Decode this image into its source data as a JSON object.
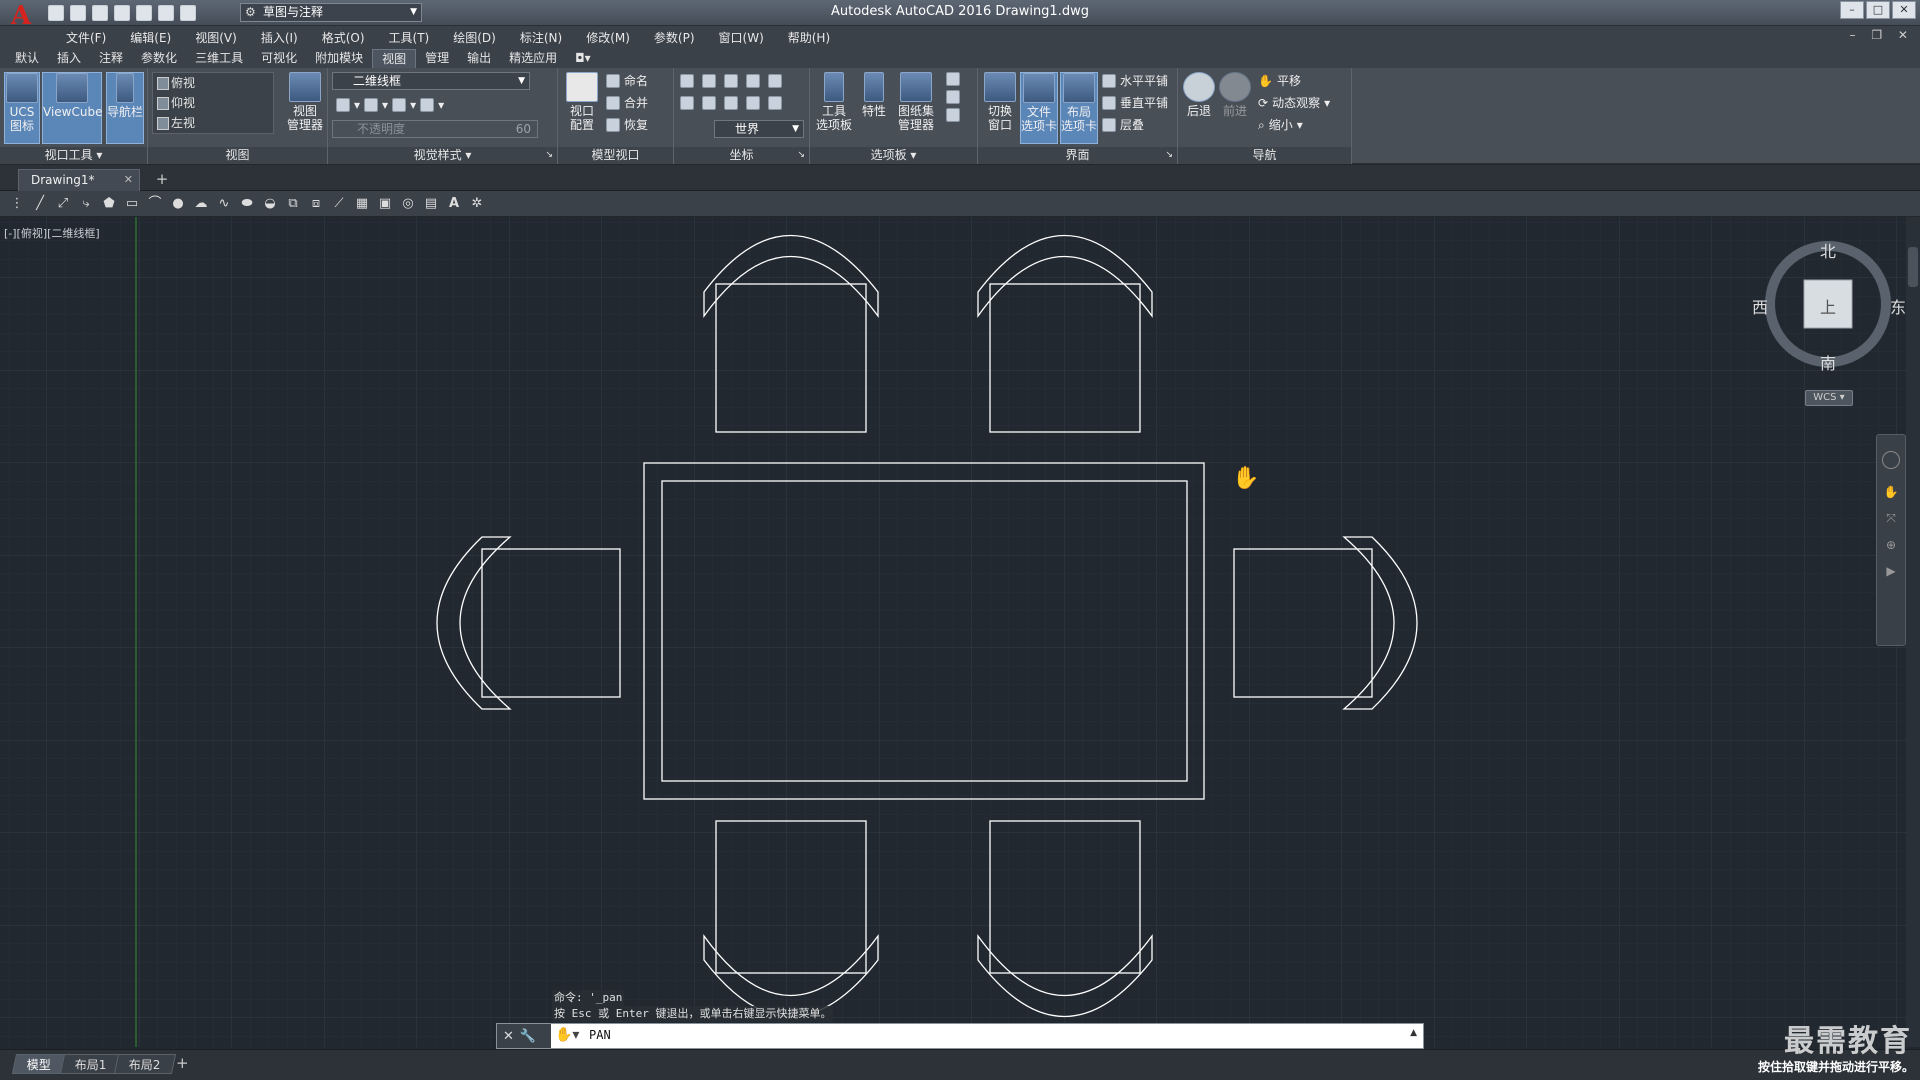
{
  "app": {
    "title": "Autodesk AutoCAD 2016    Drawing1.dwg",
    "logo": "A",
    "workspace": "草图与注释",
    "window_controls": [
      "–",
      "□",
      "✕"
    ]
  },
  "menu": [
    "文件(F)",
    "编辑(E)",
    "视图(V)",
    "插入(I)",
    "格式(O)",
    "工具(T)",
    "绘图(D)",
    "标注(N)",
    "修改(M)",
    "参数(P)",
    "窗口(W)",
    "帮助(H)"
  ],
  "ribbon_tabs": [
    "默认",
    "插入",
    "注释",
    "参数化",
    "三维工具",
    "可视化",
    "附加模块",
    "视图",
    "管理",
    "输出",
    "精选应用"
  ],
  "active_tab": "视图",
  "ribbon": {
    "viewport_tools": {
      "title": "视口工具",
      "ucs": "UCS\n图标",
      "viewcube": "ViewCube",
      "navbar": "导航栏"
    },
    "views": {
      "title": "视图",
      "items": [
        "俯视",
        "仰视",
        "左视"
      ],
      "manager": "视图\n管理器"
    },
    "visual_styles": {
      "title": "视觉样式",
      "current": "二维线框",
      "opacity_placeholder": "不透明度",
      "opacity_value": "60"
    },
    "model_viewports": {
      "title": "模型视口",
      "config": "视口\n配置",
      "named": "命名",
      "join": "合并",
      "restore": "恢复"
    },
    "coordinates": {
      "title": "坐标",
      "ucs_combo": "世界"
    },
    "palettes": {
      "title": "选项板",
      "tool_palettes": "工具\n选项板",
      "properties": "特性",
      "sheet_set": "图纸集\n管理器"
    },
    "interface": {
      "title": "界面",
      "switch_windows": "切换\n窗口",
      "file_tabs": "文件\n选项卡",
      "layout_tabs": "布局\n选项卡",
      "tile_h": "水平平铺",
      "tile_v": "垂直平铺",
      "cascade": "层叠"
    },
    "navigate": {
      "title": "导航",
      "back": "后退",
      "forward": "前进",
      "pan": "平移",
      "orbit": "动态观察",
      "zoom": "缩小"
    }
  },
  "document_tab": "Drawing1*",
  "viewport_label": "[-][俯视][二维线框]",
  "viewcube": {
    "north": "北",
    "south": "南",
    "east": "东",
    "west": "西",
    "face": "上",
    "wcs": "WCS"
  },
  "command": {
    "history": [
      "命令: '_pan",
      "按 Esc 或 Enter 键退出，或单击右键显示快捷菜单。"
    ],
    "current": "PAN"
  },
  "layout_tabs": [
    "模型",
    "布局1",
    "布局2"
  ],
  "active_layout": "模型",
  "watermark": "最需教育",
  "status_hint": "按住拾取键并拖动进行平移。",
  "colors": {
    "canvas": "#212830",
    "grid_minor": "#2a323c",
    "grid_major": "#35404c",
    "drawing_lines": "#ffffff",
    "y_axis": "#2f6b2f"
  }
}
